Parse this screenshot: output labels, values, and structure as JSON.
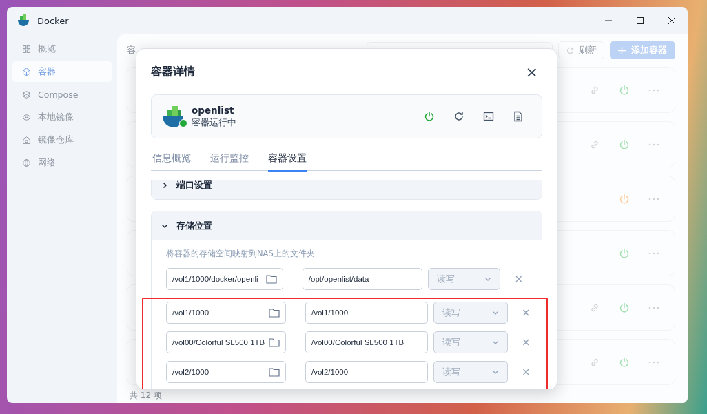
{
  "window": {
    "title": "Docker"
  },
  "sidebar": {
    "items": [
      {
        "label": "概览",
        "selected": false
      },
      {
        "label": "容器",
        "selected": true
      },
      {
        "label": "Compose",
        "selected": false
      },
      {
        "label": "本地镜像",
        "selected": false
      },
      {
        "label": "镜像仓库",
        "selected": false
      },
      {
        "label": "网络",
        "selected": false
      }
    ]
  },
  "list": {
    "title": "容",
    "refresh_button": "刷新",
    "add_button": "添加容器",
    "rows": [
      {
        "has_link": true,
        "color": "#a3e0b0"
      },
      {
        "has_link": true,
        "color": "#a3e0b0"
      },
      {
        "has_link": false,
        "color": "#fbcf9c"
      },
      {
        "has_link": false,
        "color": "#a3e0b0"
      },
      {
        "has_link": true,
        "color": "#a3e0b0"
      },
      {
        "has_link": true,
        "color": "#a3e0b0"
      }
    ],
    "footer": "共 12 项"
  },
  "dialog": {
    "title": "容器详情",
    "close": "×",
    "container": {
      "name": "openlist",
      "status": "容器运行中",
      "running": true
    },
    "tabs": [
      {
        "label": "信息概览",
        "selected": false
      },
      {
        "label": "运行监控",
        "selected": false
      },
      {
        "label": "容器设置",
        "selected": true
      }
    ],
    "sections": [
      {
        "title": "端口设置",
        "expanded": false
      },
      {
        "title": "存储位置",
        "expanded": true,
        "hint": "将容器的存储空间映射到NAS上的文件夹",
        "mounts": [
          {
            "host": "/vol1/1000/docker/openli",
            "container": "/opt/openlist/data",
            "mode": "读写",
            "disabled": true,
            "remove": "×",
            "highlighted": false
          },
          {
            "host": "/vol1/1000",
            "container": "/vol1/1000",
            "mode": "读写",
            "disabled": true,
            "remove": "×",
            "highlighted": true
          },
          {
            "host": "/vol00/Colorful SL500 1TB",
            "container": "/vol00/Colorful SL500 1TB",
            "mode": "读写",
            "disabled": true,
            "remove": "×",
            "highlighted": true
          },
          {
            "host": "/vol2/1000",
            "container": "/vol2/1000",
            "mode": "读写",
            "disabled": true,
            "remove": "×",
            "highlighted": true
          }
        ]
      }
    ]
  }
}
